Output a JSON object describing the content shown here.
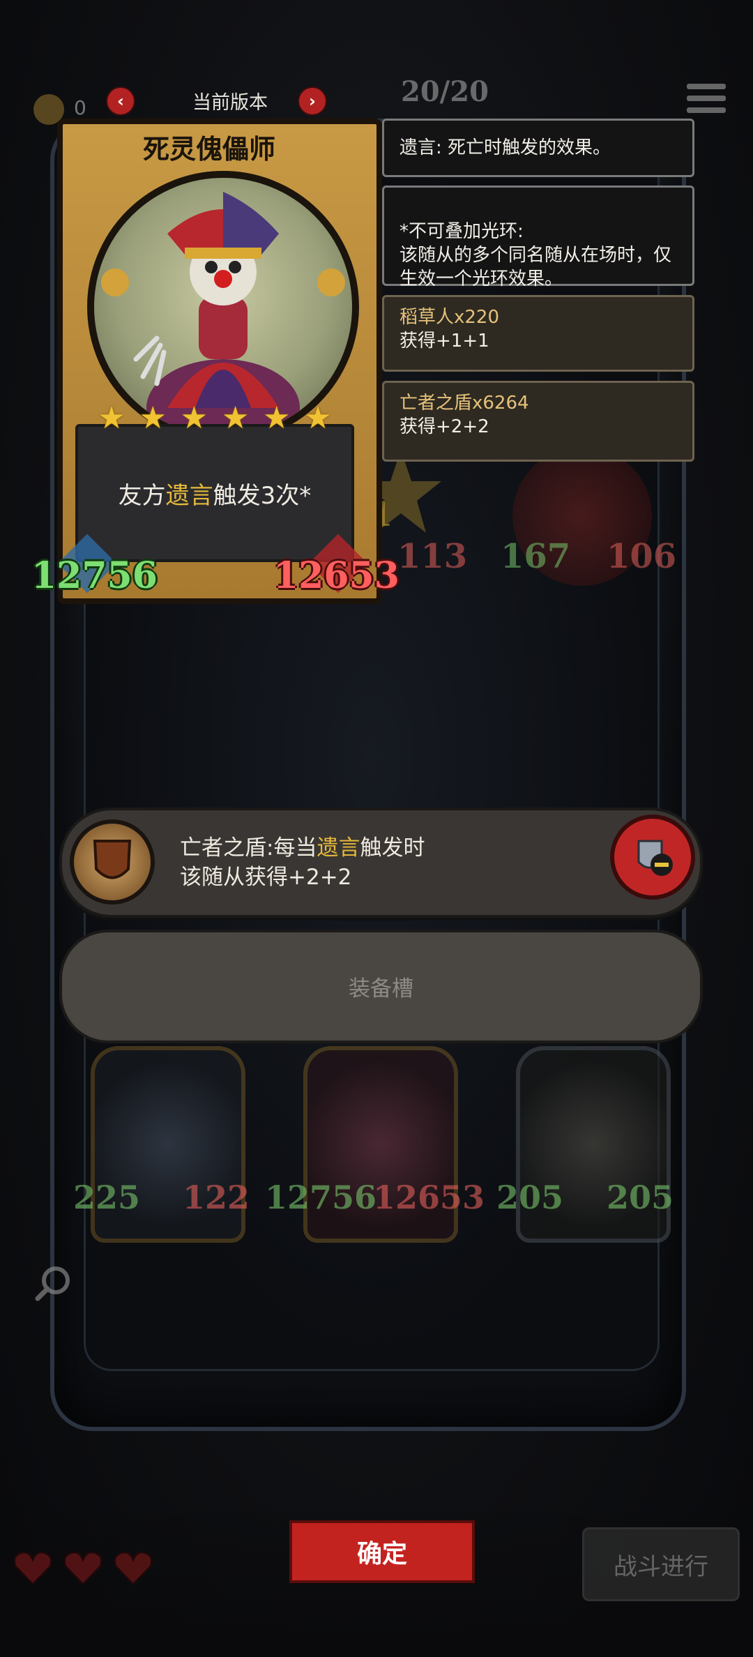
{
  "top_bar": {
    "coin_count": "0",
    "version_label": "当前版本",
    "counter": "20/20",
    "prev_icon": "chevron-left-icon",
    "next_icon": "chevron-right-icon"
  },
  "card": {
    "name": "死灵傀儡师",
    "stars": 6,
    "description_prefix": "友方",
    "description_keyword": "遗言",
    "description_suffix": "触发3次*",
    "attack": "12756",
    "health": "12653"
  },
  "tips": [
    {
      "text": "遗言: 死亡时触发的效果。"
    },
    {
      "text": "*不可叠加光环:\n该随从的多个同名随从在场时，仅生效一个光环效果。"
    }
  ],
  "buffs": [
    {
      "source": "稻草人x220",
      "effect": "获得+1+1"
    },
    {
      "source": "亡者之盾x6264",
      "effect": "获得+2+2"
    }
  ],
  "background_minion": {
    "left_attack": "113",
    "right_attack": "167",
    "right_health": "106",
    "star_level": "1"
  },
  "equipment": {
    "name_prefix": "亡者之盾:每当",
    "keyword": "遗言",
    "name_suffix": "触发时",
    "line2": "该随从获得+2+2",
    "slot_label": "装备槽"
  },
  "bottom_minions": [
    {
      "attack": "225",
      "health": "122"
    },
    {
      "attack": "12756",
      "health": "12653"
    },
    {
      "attack": "205",
      "health": "205"
    }
  ],
  "footer": {
    "hearts": 3,
    "confirm_label": "确定",
    "battle_label": "战斗进行"
  },
  "colors": {
    "accent_red": "#c3231f",
    "keyword_gold": "#e6b93a",
    "attack_green": "#7dde73",
    "health_red": "#ff5f5f"
  }
}
